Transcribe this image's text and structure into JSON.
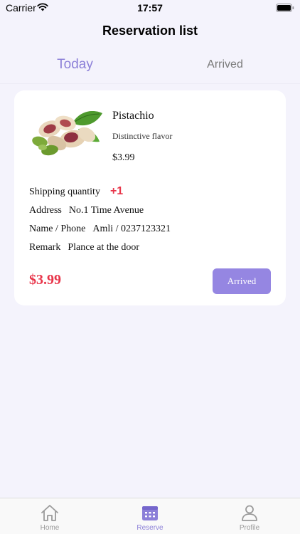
{
  "status_bar": {
    "carrier": "Carrier",
    "time": "17:57"
  },
  "header": {
    "title": "Reservation list"
  },
  "tabs": [
    {
      "label": "Today",
      "active": true
    },
    {
      "label": "Arrived",
      "active": false
    }
  ],
  "reservation": {
    "product_name": "Pistachio",
    "product_description": "Distinctive flavor",
    "product_price": "$3.99",
    "image_icon": "pistachio-image",
    "rows": {
      "quantity_label": "Shipping quantity",
      "quantity_value": "+1",
      "address_label": "Address",
      "address_value": "No.1 Time Avenue",
      "name_label": "Name / Phone",
      "name_value": "Amli / 0237123321",
      "remark_label": "Remark",
      "remark_value": "Plance at the door"
    },
    "total_price": "$3.99",
    "action_label": "Arrived"
  },
  "bottom_nav": [
    {
      "label": "Home",
      "icon": "home-icon",
      "active": false
    },
    {
      "label": "Reserve",
      "icon": "calendar-icon",
      "active": true
    },
    {
      "label": "Profile",
      "icon": "person-icon",
      "active": false
    }
  ],
  "colors": {
    "accent": "#9586E2",
    "price": "#E8354A",
    "background": "#F4F3FC"
  }
}
